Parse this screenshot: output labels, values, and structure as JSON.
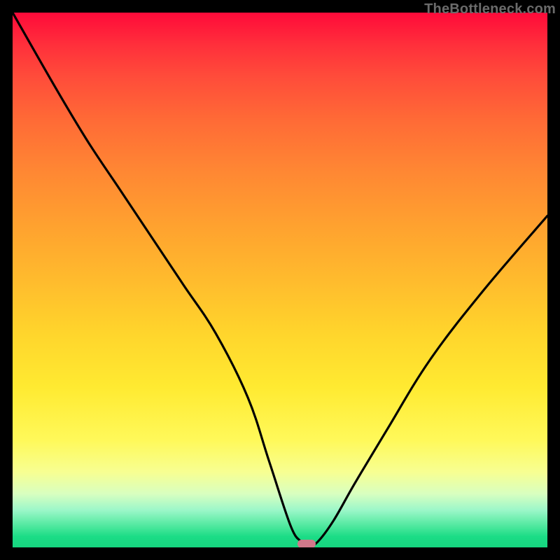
{
  "attribution": "TheBottleneck.com",
  "colors": {
    "curve_stroke": "#000000",
    "marker_fill": "#d1788a",
    "background": "#000000"
  },
  "chart_data": {
    "type": "line",
    "title": "",
    "xlabel": "",
    "ylabel": "",
    "xlim": [
      0,
      100
    ],
    "ylim": [
      0,
      100
    ],
    "valley_x": 55,
    "series": [
      {
        "name": "bottleneck-curve",
        "x": [
          0,
          8,
          14,
          20,
          26,
          32,
          38,
          44,
          48,
          52,
          54,
          55,
          57,
          60,
          64,
          70,
          78,
          88,
          100
        ],
        "values": [
          100,
          86,
          76,
          67,
          58,
          49,
          40,
          28,
          16,
          4,
          1,
          0,
          1,
          5,
          12,
          22,
          35,
          48,
          62
        ]
      }
    ],
    "background_gradient_stops": [
      {
        "pos": 0,
        "color": "#ff0a3a"
      },
      {
        "pos": 6,
        "color": "#ff2f3b"
      },
      {
        "pos": 12,
        "color": "#ff4c3a"
      },
      {
        "pos": 20,
        "color": "#ff6a36"
      },
      {
        "pos": 30,
        "color": "#ff8833"
      },
      {
        "pos": 40,
        "color": "#ffa22f"
      },
      {
        "pos": 50,
        "color": "#ffbb2d"
      },
      {
        "pos": 60,
        "color": "#ffd52c"
      },
      {
        "pos": 70,
        "color": "#ffea31"
      },
      {
        "pos": 80,
        "color": "#fff95a"
      },
      {
        "pos": 86,
        "color": "#f7ff93"
      },
      {
        "pos": 90,
        "color": "#d8ffc0"
      },
      {
        "pos": 93,
        "color": "#9cf7c9"
      },
      {
        "pos": 96,
        "color": "#4fe89e"
      },
      {
        "pos": 98,
        "color": "#1bdc86"
      },
      {
        "pos": 100,
        "color": "#16d57f"
      }
    ]
  }
}
